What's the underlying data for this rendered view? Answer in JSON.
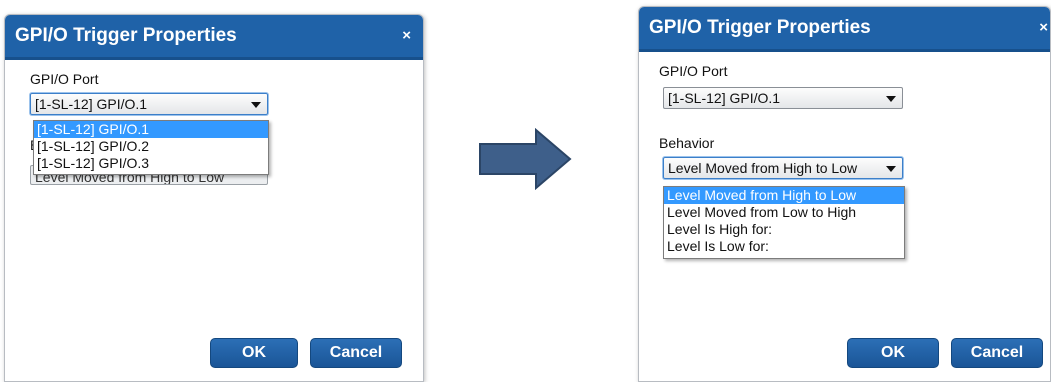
{
  "left_dialog": {
    "title": "GPI/O Trigger Properties",
    "close_glyph": "×",
    "port_label": "GPI/O Port",
    "port_value": "[1-SL-12] GPI/O.1",
    "port_options": [
      "[1-SL-12] GPI/O.1",
      "[1-SL-12] GPI/O.2",
      "[1-SL-12] GPI/O.3"
    ],
    "port_selected_index": 0,
    "behavior_label_partial": "B",
    "behavior_value_obscured": "Level Moved from High to Low",
    "ok_label": "OK",
    "cancel_label": "Cancel"
  },
  "right_dialog": {
    "title": "GPI/O Trigger Properties",
    "close_glyph": "×",
    "port_label": "GPI/O Port",
    "port_value": "[1-SL-12] GPI/O.1",
    "behavior_label": "Behavior",
    "behavior_value": "Level Moved from High to Low",
    "behavior_options": [
      "Level Moved from High to Low",
      "Level Moved from Low to High",
      "Level Is High for:",
      "Level Is Low for:"
    ],
    "behavior_selected_index": 0,
    "ok_label": "OK",
    "cancel_label": "Cancel"
  },
  "colors": {
    "titlebar": "#1f62a8",
    "button": "#1a5597",
    "selection": "#3399ff",
    "arrow_fill": "#3e5f8a"
  },
  "icons": {
    "transition_arrow": "right-arrow-icon",
    "combo_arrow": "chevron-down-icon"
  }
}
